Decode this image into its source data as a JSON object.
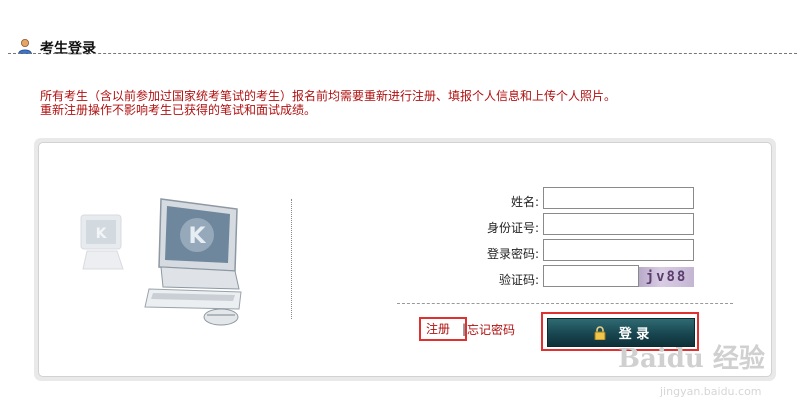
{
  "header": {
    "title": "考生登录",
    "icon": "user-icon"
  },
  "notice": {
    "line1": "所有考生（含以前参加过国家统考笔试的考生）报名前均需要重新进行注册、填报个人信息和上传个人照片。",
    "line2": "重新注册操作不影响考生已获得的笔试和面试成绩。"
  },
  "form": {
    "name_label": "姓名:",
    "name_value": "",
    "id_label": "身份证号:",
    "id_value": "",
    "password_label": "登录密码:",
    "password_value": "",
    "captcha_label": "验证码:",
    "captcha_value": "",
    "captcha_image_text": "jv88"
  },
  "links": {
    "register": "注册",
    "separator": "|",
    "forgot": "忘记密码"
  },
  "login_button": {
    "label": "登 录",
    "icon": "lock-icon"
  },
  "watermark": {
    "brand": "Baidu 经验",
    "url": "jingyan.baidu.com"
  },
  "colors": {
    "notice_red": "#b01010",
    "highlight_red": "#e03030",
    "button_teal": "#184650"
  }
}
